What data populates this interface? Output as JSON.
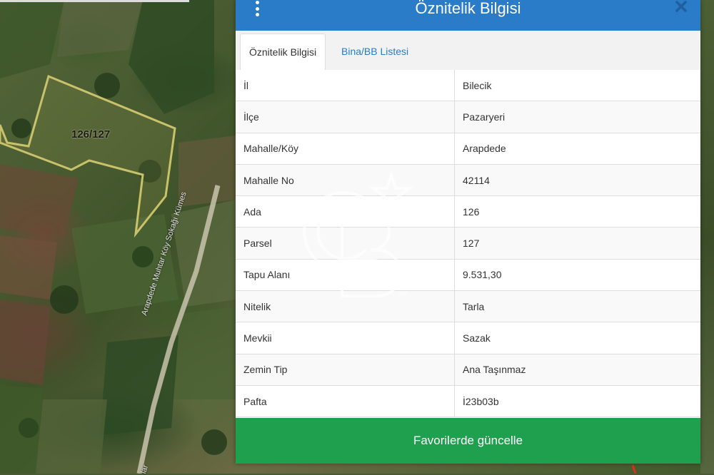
{
  "map": {
    "parcel_label": "126/127",
    "road_label": "Arapdede Muhtar Köy Sokağı Kümes",
    "road_label_bottom": "lar"
  },
  "panel": {
    "title": "Öznitelik Bilgisi",
    "menu_icon": "kebab-menu-icon",
    "close_icon": "close-icon",
    "tabs": [
      {
        "label": "Öznitelik Bilgisi",
        "active": true
      },
      {
        "label": "Bina/BB Listesi",
        "active": false
      }
    ],
    "rows": [
      {
        "key": "İl",
        "value": "Bilecik"
      },
      {
        "key": "İlçe",
        "value": "Pazaryeri"
      },
      {
        "key": "Mahalle/Köy",
        "value": "Arapdede"
      },
      {
        "key": "Mahalle No",
        "value": "42114"
      },
      {
        "key": "Ada",
        "value": "126"
      },
      {
        "key": "Parsel",
        "value": "127"
      },
      {
        "key": "Tapu Alanı",
        "value": "9.531,30"
      },
      {
        "key": "Nitelik",
        "value": "Tarla"
      },
      {
        "key": "Mevkii",
        "value": "Sazak"
      },
      {
        "key": "Zemin Tip",
        "value": "Ana Taşınmaz"
      },
      {
        "key": "Pafta",
        "value": "İ23b03b"
      }
    ],
    "button_label": "Favorilerde güncelle"
  },
  "watermark": {
    "mark": "CB",
    "suffix": "SM"
  },
  "colors": {
    "header": "#2a7bc8",
    "button": "#1ea04f",
    "tab_link": "#2a7bc8",
    "parcel_outline": "#c9c26a"
  }
}
